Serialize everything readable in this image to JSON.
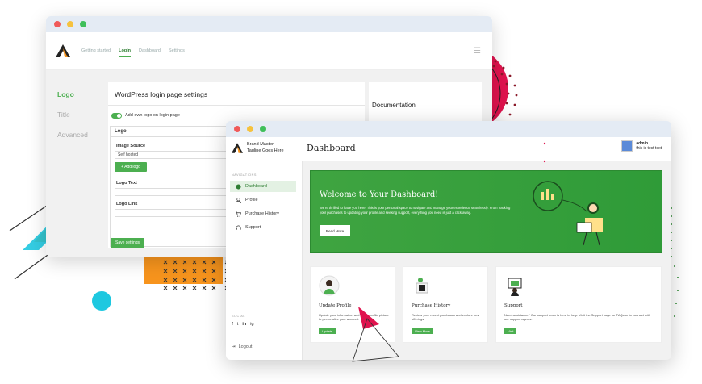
{
  "colors": {
    "accent": "#4caf50",
    "pink": "#e0134e",
    "cyan": "#1ec8e0",
    "orange": "#f7941d"
  },
  "back_window": {
    "tabs": [
      "Getting started",
      "Login",
      "Dashboard",
      "Settings"
    ],
    "active_tab": "Login",
    "sidebar": [
      "Logo",
      "Title",
      "Advanced"
    ],
    "panel_title": "WordPress login page settings",
    "toggle_label": "Add own logo on login page",
    "logo_section": "Logo",
    "image_source_label": "Image Source",
    "image_source_value": "Self hosted",
    "add_logo_button": "+ Add logo",
    "logo_text_label": "Logo Text",
    "logo_link_label": "Logo Link",
    "save_button": "Save settings",
    "doc_title": "Documentation"
  },
  "front_window": {
    "brand_name": "Brand Master",
    "brand_tagline": "Tagline Goes Here",
    "page_title": "Dashboard",
    "user_name": "admin",
    "user_desc": "this is test text",
    "nav_heading": "NAVIGATIONS",
    "nav": [
      {
        "label": "Dashboard",
        "icon": "dashboard-icon"
      },
      {
        "label": "Profile",
        "icon": "user-icon"
      },
      {
        "label": "Purchase History",
        "icon": "cart-icon"
      },
      {
        "label": "Support",
        "icon": "headset-icon"
      }
    ],
    "social_heading": "SOCIAL",
    "social_icons": [
      "f",
      "t",
      "in",
      "ig"
    ],
    "logout": "Logout",
    "banner": {
      "title": "Welcome to Your Dashboard!",
      "text": "We're thrilled to have you here! This is your personal space to navigate and manage your experience seamlessly. From tracking your purchases to updating your profile and seeking support, everything you need is just a click away.",
      "button": "Read More"
    },
    "cards": [
      {
        "title": "Update Profile",
        "text": "Update your information and add a profile picture to personalize your account.",
        "button": "Update"
      },
      {
        "title": "Purchase History",
        "text": "Review your recent purchases and explore new offerings.",
        "button": "View More"
      },
      {
        "title": "Support",
        "text": "Need assistance? Our support team is here to help. Visit the Support page for FAQs or to connect with our support agents.",
        "button": "Visit"
      }
    ]
  }
}
